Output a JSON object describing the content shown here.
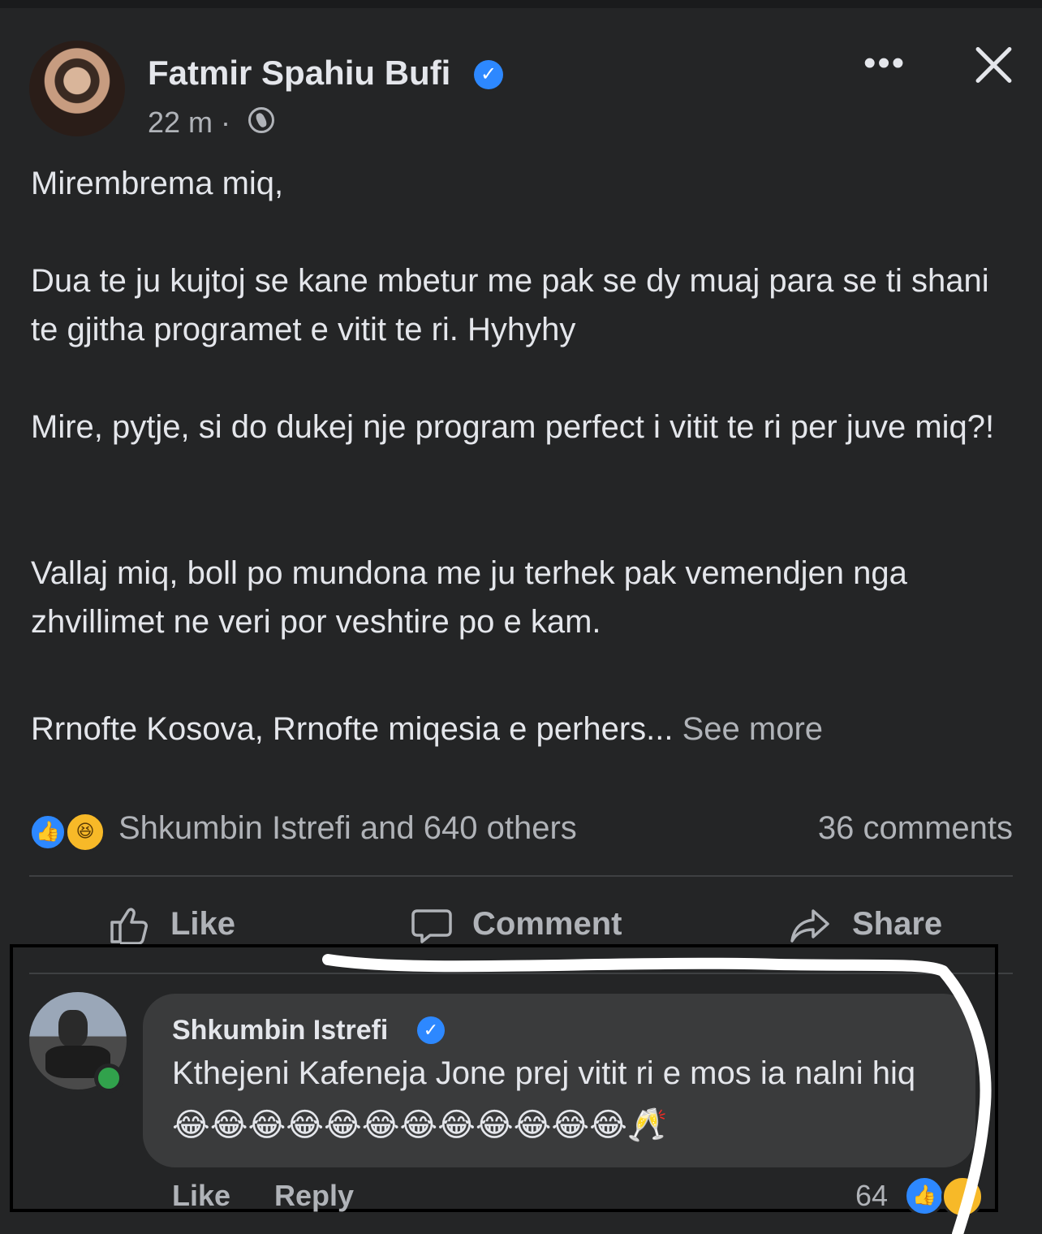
{
  "post": {
    "author": "Fatmir Spahiu Bufi",
    "verified_glyph": "✓",
    "time": "22 m ·",
    "privacy_icon": "globe-icon",
    "more_icon": "•••",
    "paragraphs": [
      "Mirembrema miq,",
      "Dua te ju kujtoj se kane mbetur me pak se dy muaj para se ti shani te gjitha programet e vitit te ri. Hyhyhy",
      "Mire, pytje, si do dukej nje program perfect i vitit te ri per juve miq?!",
      "Vallaj miq, boll po mundona me ju terhek pak vemendjen nga zhvillimet ne veri por veshtire po e kam."
    ],
    "last_paragraph": "Rrnofte Kosova, Rrnofte miqesia e perhers...",
    "see_more": "See more"
  },
  "reactions": {
    "like_glyph": "👍",
    "haha_glyph": "😆",
    "summary": "Shkumbin Istrefi and 640 others",
    "comments": "36 comments"
  },
  "actions": {
    "like": "Like",
    "comment": "Comment",
    "share": "Share"
  },
  "comment": {
    "author": "Shkumbin Istrefi",
    "verified_glyph": "✓",
    "text": "Kthejeni Kafeneja Jone prej vitit ri e mos ia nalni hiq 😂😂😂😂😂😂😂😂😂😂😂😂🥂",
    "like": "Like",
    "reply": "Reply",
    "reaction_count": "64",
    "like_glyph": "👍"
  },
  "colors": {
    "background": "#242526",
    "bubble": "#3a3b3c",
    "accent": "#2d88ff",
    "online": "#31a24c"
  }
}
